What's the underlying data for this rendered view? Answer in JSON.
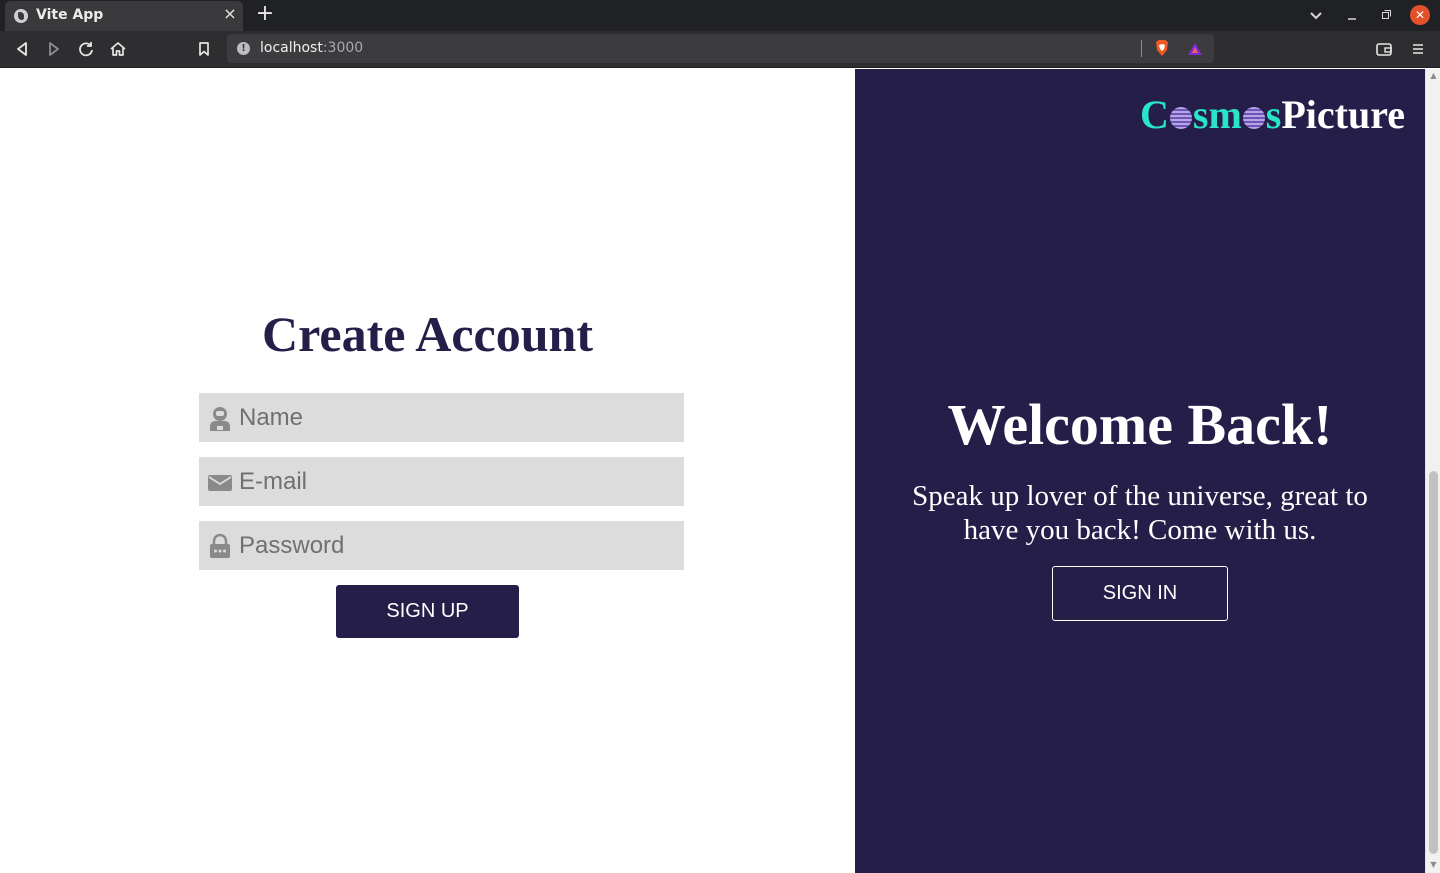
{
  "browser": {
    "tab_title": "Vite App",
    "tab_close": "×",
    "new_tab": "+",
    "url_host": "localhost",
    "url_port": ":3000",
    "window_close": "✕"
  },
  "signup": {
    "heading": "Create Account",
    "name_placeholder": "Name",
    "email_placeholder": "E-mail",
    "password_placeholder": "Password",
    "submit_label": "SIGN UP"
  },
  "welcome": {
    "logo_c": "C",
    "logo_sm": "sm",
    "logo_s": "s",
    "logo_picture": "Picture",
    "heading": "Welcome Back!",
    "text": "Speak up lover of the universe, great to have you back! Come with us.",
    "signin_label": "SIGN IN"
  },
  "colors": {
    "brand_dark": "#251e49",
    "logo_accent": "#2ae3c8",
    "input_bg": "#dcdcdc"
  }
}
